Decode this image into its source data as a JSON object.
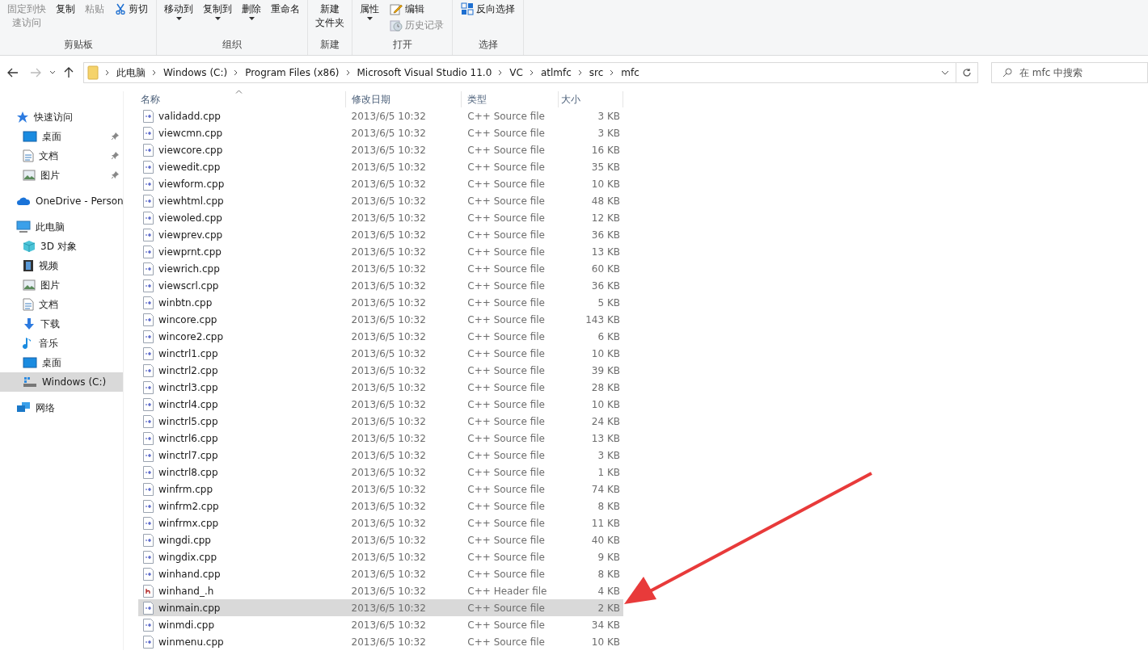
{
  "ribbon": {
    "groups": [
      {
        "label": "剪贴板",
        "buttons": [
          {
            "lines": [
              "固定到快",
              "速访问"
            ],
            "disabled": true,
            "dropdown": false
          },
          {
            "lines": [
              "复制"
            ],
            "disabled": false,
            "dropdown": false
          },
          {
            "lines": [
              "粘贴"
            ],
            "disabled": true,
            "dropdown": false
          }
        ],
        "small": [
          {
            "label": "剪切",
            "kind": "scissors",
            "disabled": false
          }
        ]
      },
      {
        "label": "组织",
        "buttons": [
          {
            "lines": [
              "移动到"
            ],
            "disabled": false,
            "dropdown": true
          },
          {
            "lines": [
              "复制到"
            ],
            "disabled": false,
            "dropdown": true
          },
          {
            "lines": [
              "删除"
            ],
            "disabled": false,
            "dropdown": true
          },
          {
            "lines": [
              "重命名"
            ],
            "disabled": false,
            "dropdown": false
          }
        ]
      },
      {
        "label": "新建",
        "buttons": [
          {
            "lines": [
              "新建",
              "文件夹"
            ],
            "disabled": false,
            "dropdown": false
          }
        ]
      },
      {
        "label": "打开",
        "buttons": [
          {
            "lines": [
              "属性"
            ],
            "disabled": false,
            "dropdown": true
          }
        ],
        "small": [
          {
            "label": "编辑",
            "kind": "pencil",
            "disabled": false
          },
          {
            "label": "历史记录",
            "kind": "history",
            "disabled": true
          }
        ]
      },
      {
        "label": "选择",
        "small": [
          {
            "label": "反向选择",
            "kind": "grid",
            "disabled": false
          }
        ]
      }
    ]
  },
  "address": {
    "crumbs": [
      "此电脑",
      "Windows (C:)",
      "Program Files (x86)",
      "Microsoft Visual Studio 11.0",
      "VC",
      "atlmfc",
      "src",
      "mfc"
    ]
  },
  "search": {
    "placeholder": "在 mfc 中搜索"
  },
  "sidebar": {
    "items": [
      {
        "label": "快速访问",
        "kind": "star",
        "selected": false,
        "children": [
          {
            "label": "桌面",
            "kind": "desktop",
            "pinned": true,
            "selected": false
          },
          {
            "label": "文档",
            "kind": "doc",
            "pinned": true,
            "selected": false
          },
          {
            "label": "图片",
            "kind": "image",
            "pinned": true,
            "selected": false
          }
        ]
      },
      {
        "label": "OneDrive - Person",
        "kind": "cloud",
        "selected": false
      },
      {
        "label": "此电脑",
        "kind": "pc",
        "selected": false,
        "children": [
          {
            "label": "3D 对象",
            "kind": "cube",
            "pinned": false,
            "selected": false
          },
          {
            "label": "视频",
            "kind": "film",
            "pinned": false,
            "selected": false
          },
          {
            "label": "图片",
            "kind": "image",
            "pinned": false,
            "selected": false
          },
          {
            "label": "文档",
            "kind": "doc",
            "pinned": false,
            "selected": false
          },
          {
            "label": "下载",
            "kind": "download",
            "pinned": false,
            "selected": false
          },
          {
            "label": "音乐",
            "kind": "music",
            "pinned": false,
            "selected": false
          },
          {
            "label": "桌面",
            "kind": "desktop",
            "pinned": false,
            "selected": false
          },
          {
            "label": "Windows (C:)",
            "kind": "drive",
            "pinned": false,
            "selected": true
          }
        ]
      },
      {
        "label": "网络",
        "kind": "network",
        "selected": false
      }
    ]
  },
  "table": {
    "columns": [
      "名称",
      "修改日期",
      "类型",
      "大小"
    ],
    "rows": [
      {
        "name": "validadd.cpp",
        "date": "2013/6/5 10:32",
        "type": "C++ Source file",
        "size": "3 KB",
        "kind": "cpp",
        "selected": false
      },
      {
        "name": "viewcmn.cpp",
        "date": "2013/6/5 10:32",
        "type": "C++ Source file",
        "size": "3 KB",
        "kind": "cpp",
        "selected": false
      },
      {
        "name": "viewcore.cpp",
        "date": "2013/6/5 10:32",
        "type": "C++ Source file",
        "size": "16 KB",
        "kind": "cpp",
        "selected": false
      },
      {
        "name": "viewedit.cpp",
        "date": "2013/6/5 10:32",
        "type": "C++ Source file",
        "size": "35 KB",
        "kind": "cpp",
        "selected": false
      },
      {
        "name": "viewform.cpp",
        "date": "2013/6/5 10:32",
        "type": "C++ Source file",
        "size": "10 KB",
        "kind": "cpp",
        "selected": false
      },
      {
        "name": "viewhtml.cpp",
        "date": "2013/6/5 10:32",
        "type": "C++ Source file",
        "size": "48 KB",
        "kind": "cpp",
        "selected": false
      },
      {
        "name": "viewoled.cpp",
        "date": "2013/6/5 10:32",
        "type": "C++ Source file",
        "size": "12 KB",
        "kind": "cpp",
        "selected": false
      },
      {
        "name": "viewprev.cpp",
        "date": "2013/6/5 10:32",
        "type": "C++ Source file",
        "size": "36 KB",
        "kind": "cpp",
        "selected": false
      },
      {
        "name": "viewprnt.cpp",
        "date": "2013/6/5 10:32",
        "type": "C++ Source file",
        "size": "13 KB",
        "kind": "cpp",
        "selected": false
      },
      {
        "name": "viewrich.cpp",
        "date": "2013/6/5 10:32",
        "type": "C++ Source file",
        "size": "60 KB",
        "kind": "cpp",
        "selected": false
      },
      {
        "name": "viewscrl.cpp",
        "date": "2013/6/5 10:32",
        "type": "C++ Source file",
        "size": "36 KB",
        "kind": "cpp",
        "selected": false
      },
      {
        "name": "winbtn.cpp",
        "date": "2013/6/5 10:32",
        "type": "C++ Source file",
        "size": "5 KB",
        "kind": "cpp",
        "selected": false
      },
      {
        "name": "wincore.cpp",
        "date": "2013/6/5 10:32",
        "type": "C++ Source file",
        "size": "143 KB",
        "kind": "cpp",
        "selected": false
      },
      {
        "name": "wincore2.cpp",
        "date": "2013/6/5 10:32",
        "type": "C++ Source file",
        "size": "6 KB",
        "kind": "cpp",
        "selected": false
      },
      {
        "name": "winctrl1.cpp",
        "date": "2013/6/5 10:32",
        "type": "C++ Source file",
        "size": "10 KB",
        "kind": "cpp",
        "selected": false
      },
      {
        "name": "winctrl2.cpp",
        "date": "2013/6/5 10:32",
        "type": "C++ Source file",
        "size": "39 KB",
        "kind": "cpp",
        "selected": false
      },
      {
        "name": "winctrl3.cpp",
        "date": "2013/6/5 10:32",
        "type": "C++ Source file",
        "size": "28 KB",
        "kind": "cpp",
        "selected": false
      },
      {
        "name": "winctrl4.cpp",
        "date": "2013/6/5 10:32",
        "type": "C++ Source file",
        "size": "10 KB",
        "kind": "cpp",
        "selected": false
      },
      {
        "name": "winctrl5.cpp",
        "date": "2013/6/5 10:32",
        "type": "C++ Source file",
        "size": "24 KB",
        "kind": "cpp",
        "selected": false
      },
      {
        "name": "winctrl6.cpp",
        "date": "2013/6/5 10:32",
        "type": "C++ Source file",
        "size": "13 KB",
        "kind": "cpp",
        "selected": false
      },
      {
        "name": "winctrl7.cpp",
        "date": "2013/6/5 10:32",
        "type": "C++ Source file",
        "size": "3 KB",
        "kind": "cpp",
        "selected": false
      },
      {
        "name": "winctrl8.cpp",
        "date": "2013/6/5 10:32",
        "type": "C++ Source file",
        "size": "1 KB",
        "kind": "cpp",
        "selected": false
      },
      {
        "name": "winfrm.cpp",
        "date": "2013/6/5 10:32",
        "type": "C++ Source file",
        "size": "74 KB",
        "kind": "cpp",
        "selected": false
      },
      {
        "name": "winfrm2.cpp",
        "date": "2013/6/5 10:32",
        "type": "C++ Source file",
        "size": "8 KB",
        "kind": "cpp",
        "selected": false
      },
      {
        "name": "winfrmx.cpp",
        "date": "2013/6/5 10:32",
        "type": "C++ Source file",
        "size": "11 KB",
        "kind": "cpp",
        "selected": false
      },
      {
        "name": "wingdi.cpp",
        "date": "2013/6/5 10:32",
        "type": "C++ Source file",
        "size": "40 KB",
        "kind": "cpp",
        "selected": false
      },
      {
        "name": "wingdix.cpp",
        "date": "2013/6/5 10:32",
        "type": "C++ Source file",
        "size": "9 KB",
        "kind": "cpp",
        "selected": false
      },
      {
        "name": "winhand.cpp",
        "date": "2013/6/5 10:32",
        "type": "C++ Source file",
        "size": "8 KB",
        "kind": "cpp",
        "selected": false
      },
      {
        "name": "winhand_.h",
        "date": "2013/6/5 10:32",
        "type": "C++ Header file",
        "size": "4 KB",
        "kind": "h",
        "selected": false
      },
      {
        "name": "winmain.cpp",
        "date": "2013/6/5 10:32",
        "type": "C++ Source file",
        "size": "2 KB",
        "kind": "cpp",
        "selected": true
      },
      {
        "name": "winmdi.cpp",
        "date": "2013/6/5 10:32",
        "type": "C++ Source file",
        "size": "34 KB",
        "kind": "cpp",
        "selected": false
      },
      {
        "name": "winmenu.cpp",
        "date": "2013/6/5 10:32",
        "type": "C++ Source file",
        "size": "10 KB",
        "kind": "cpp",
        "selected": false
      }
    ]
  }
}
